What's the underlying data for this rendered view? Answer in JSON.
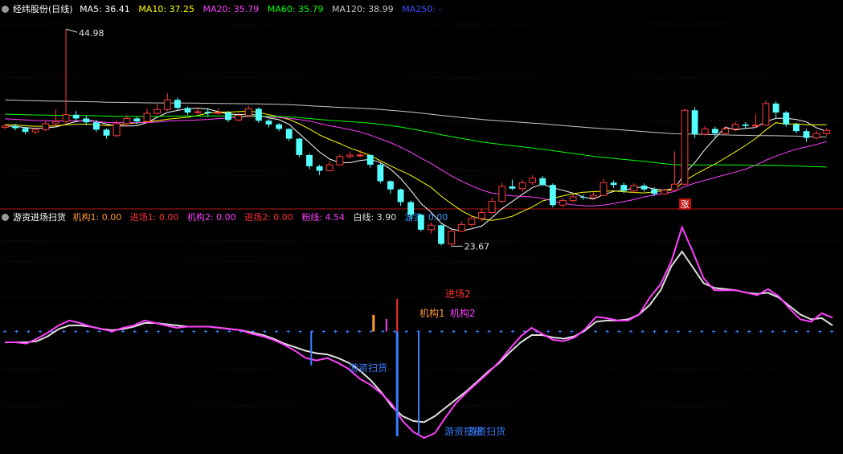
{
  "main_header": {
    "title": "经纬股份(日线)",
    "indicators": [
      {
        "label": "MA5: 36.41",
        "color": "#ffffff"
      },
      {
        "label": "MA10: 37.25",
        "color": "#ffff00"
      },
      {
        "label": "MA20: 35.79",
        "color": "#ff40ff"
      },
      {
        "label": "MA60: 35.79",
        "color": "#00ff00"
      },
      {
        "label": "MA120: 38.99",
        "color": "#c8c8c8"
      },
      {
        "label": "MA250: -",
        "color": "#3c50ff"
      }
    ]
  },
  "sub_header": {
    "title": "游资进场扫货",
    "indicators": [
      {
        "label": "机构1: 0.00",
        "color": "#ff9933"
      },
      {
        "label": "进场1: 0.00",
        "color": "#ff3030"
      },
      {
        "label": "机构2: 0.00",
        "color": "#ff40ff"
      },
      {
        "label": "进场2: 0.00",
        "color": "#ff3030"
      },
      {
        "label": "粉线: 4.54",
        "color": "#ff40ff"
      },
      {
        "label": "白线: 3.90",
        "color": "#e0e0e0"
      },
      {
        "label": "游资: 0.00",
        "color": "#3399ff"
      }
    ]
  },
  "chart_data": [
    {
      "type": "candlestick",
      "title": "经纬股份(日线)",
      "price_range": [
        22.5,
        46.5
      ],
      "up_color": "#ff3c3c",
      "down_color": "#54ffff",
      "candles": [
        [
          31.8,
          32.0,
          32.2,
          31.6
        ],
        [
          32.0,
          31.7,
          32.3,
          31.4
        ],
        [
          31.7,
          31.2,
          31.9,
          30.9
        ],
        [
          31.2,
          31.5,
          31.8,
          30.9
        ],
        [
          31.5,
          32.3,
          32.7,
          31.3
        ],
        [
          32.3,
          32.6,
          34.2,
          32.0
        ],
        [
          32.6,
          33.5,
          44.98,
          32.2
        ],
        [
          33.5,
          33.0,
          34.0,
          32.6
        ],
        [
          33.0,
          32.5,
          33.4,
          32.1
        ],
        [
          32.5,
          31.5,
          32.8,
          31.2
        ],
        [
          31.5,
          30.7,
          31.7,
          30.3
        ],
        [
          30.7,
          32.3,
          32.7,
          30.5
        ],
        [
          32.3,
          33.0,
          33.4,
          31.9
        ],
        [
          33.0,
          32.6,
          33.2,
          32.2
        ],
        [
          32.6,
          33.7,
          34.3,
          32.4
        ],
        [
          33.7,
          34.2,
          34.9,
          33.5
        ],
        [
          34.2,
          35.5,
          36.4,
          34.0
        ],
        [
          35.5,
          34.4,
          35.8,
          34.2
        ],
        [
          34.4,
          33.8,
          34.6,
          33.5
        ],
        [
          33.8,
          33.9,
          34.5,
          33.6
        ],
        [
          33.9,
          33.7,
          34.4,
          33.2
        ],
        [
          33.7,
          33.8,
          34.4,
          33.5
        ],
        [
          33.8,
          32.8,
          34.0,
          32.5
        ],
        [
          32.8,
          33.4,
          33.8,
          32.6
        ],
        [
          33.4,
          34.3,
          34.7,
          33.2
        ],
        [
          34.3,
          32.7,
          34.5,
          32.4
        ],
        [
          32.7,
          32.2,
          32.9,
          31.8
        ],
        [
          32.2,
          31.6,
          32.4,
          31.3
        ],
        [
          31.6,
          30.3,
          31.7,
          30.0
        ],
        [
          30.3,
          28.1,
          30.4,
          27.8
        ],
        [
          28.1,
          26.6,
          28.3,
          26.2
        ],
        [
          26.6,
          26.0,
          26.8,
          25.4
        ],
        [
          26.0,
          26.8,
          27.3,
          25.9
        ],
        [
          26.8,
          27.9,
          28.2,
          26.7
        ],
        [
          27.9,
          28.1,
          28.6,
          27.6
        ],
        [
          28.1,
          28.1,
          28.8,
          27.8
        ],
        [
          28.1,
          26.8,
          28.2,
          26.4
        ],
        [
          26.8,
          24.6,
          27.0,
          24.3
        ],
        [
          24.6,
          23.5,
          24.7,
          22.9
        ],
        [
          23.5,
          21.8,
          23.6,
          21.3
        ],
        [
          21.8,
          20.1,
          22.0,
          19.5
        ],
        [
          20.1,
          18.1,
          20.2,
          17.9
        ],
        [
          18.1,
          18.7,
          19.1,
          17.6
        ],
        [
          18.7,
          16.2,
          18.8,
          16.0
        ],
        [
          16.2,
          17.9,
          18.1,
          15.9
        ],
        [
          17.9,
          18.8,
          19.2,
          17.8
        ],
        [
          18.8,
          19.6,
          20.0,
          18.5
        ],
        [
          19.6,
          20.4,
          20.9,
          19.2
        ],
        [
          20.4,
          21.9,
          22.4,
          20.2
        ],
        [
          21.9,
          23.9,
          24.4,
          21.7
        ],
        [
          23.9,
          23.6,
          24.8,
          23.4
        ],
        [
          23.6,
          24.4,
          24.8,
          23.2
        ],
        [
          24.4,
          25.0,
          25.4,
          24.1
        ],
        [
          25.0,
          24.1,
          25.3,
          23.9
        ],
        [
          24.1,
          21.4,
          24.3,
          21.1
        ],
        [
          21.4,
          22.0,
          22.4,
          21.1
        ],
        [
          22.0,
          22.5,
          22.9,
          21.8
        ],
        [
          22.5,
          22.4,
          22.8,
          22.1
        ],
        [
          22.4,
          22.7,
          23.1,
          22.2
        ],
        [
          22.7,
          24.4,
          24.9,
          22.6
        ],
        [
          24.4,
          24.1,
          24.7,
          23.7
        ],
        [
          24.1,
          23.3,
          24.4,
          23.0
        ],
        [
          23.3,
          24.0,
          24.3,
          23.0
        ],
        [
          24.0,
          23.5,
          24.3,
          23.2
        ],
        [
          23.5,
          22.9,
          23.8,
          22.6
        ],
        [
          22.9,
          23.4,
          23.6,
          22.8
        ],
        [
          23.4,
          24.2,
          28.6,
          24.0
        ],
        [
          24.2,
          34.1,
          34.3,
          24.1
        ],
        [
          34.1,
          30.9,
          34.5,
          30.4
        ],
        [
          30.9,
          31.6,
          32.0,
          30.7
        ],
        [
          31.6,
          31.0,
          31.9,
          30.4
        ],
        [
          31.0,
          31.6,
          32.0,
          30.8
        ],
        [
          31.6,
          32.2,
          32.5,
          31.3
        ],
        [
          32.2,
          32.0,
          32.5,
          31.6
        ],
        [
          32.0,
          32.1,
          33.6,
          31.7
        ],
        [
          32.1,
          35.0,
          35.4,
          32.0
        ],
        [
          35.0,
          33.8,
          35.3,
          33.0
        ],
        [
          33.8,
          32.2,
          34.0,
          31.9
        ],
        [
          32.2,
          31.3,
          32.4,
          31.0
        ],
        [
          31.3,
          30.4,
          31.6,
          29.9
        ],
        [
          30.4,
          31.0,
          31.4,
          30.2
        ],
        [
          31.0,
          31.4,
          31.7,
          30.7
        ]
      ],
      "annotations": [
        {
          "text": "44.98",
          "kind": "high"
        },
        {
          "text": "23.67",
          "kind": "low"
        },
        {
          "text": "涨"
        }
      ]
    },
    {
      "type": "line",
      "title": "游资进场扫货",
      "y_range": [
        0,
        12
      ],
      "base_level": 3.4,
      "series": [
        {
          "name": "粉线",
          "color": "#ff40ff",
          "values": [
            2.5,
            2.5,
            2.4,
            2.8,
            3.3,
            3.9,
            4.3,
            4.1,
            3.8,
            3.6,
            3.4,
            3.7,
            3.9,
            4.3,
            4.1,
            3.9,
            3.7,
            3.8,
            3.8,
            3.8,
            3.7,
            3.6,
            3.5,
            3.2,
            3.0,
            2.7,
            2.3,
            1.8,
            1.2,
            1.0,
            1.2,
            0.8,
            0.3,
            -0.5,
            -1.0,
            -1.7,
            -2.6,
            -4.0,
            -4.9,
            -5.4,
            -5.0,
            -3.7,
            -2.5,
            -1.6,
            -0.8,
            0.0,
            0.9,
            2.0,
            3.0,
            3.7,
            3.2,
            2.7,
            2.6,
            2.9,
            3.6,
            4.6,
            4.5,
            4.3,
            4.3,
            4.8,
            6.2,
            7.3,
            9.2,
            12.0,
            10.0,
            7.8,
            6.8,
            6.8,
            6.8,
            6.6,
            6.4,
            6.9,
            6.3,
            5.3,
            4.4,
            4.2,
            4.9,
            4.54
          ]
        },
        {
          "name": "白线",
          "color": "#e0e0e0",
          "values": [
            2.5,
            2.5,
            2.5,
            2.6,
            3.0,
            3.6,
            3.9,
            3.9,
            3.8,
            3.6,
            3.5,
            3.6,
            3.8,
            4.1,
            4.1,
            4.0,
            3.9,
            3.8,
            3.8,
            3.8,
            3.7,
            3.6,
            3.5,
            3.3,
            3.1,
            2.8,
            2.4,
            2.1,
            1.8,
            1.6,
            1.5,
            1.2,
            0.8,
            0.2,
            -0.6,
            -1.6,
            -2.8,
            -3.6,
            -4.0,
            -4.1,
            -3.6,
            -2.9,
            -2.2,
            -1.5,
            -0.7,
            0.1,
            0.8,
            1.7,
            2.5,
            3.1,
            3.1,
            2.9,
            2.8,
            3.0,
            3.5,
            4.2,
            4.3,
            4.3,
            4.4,
            4.8,
            5.6,
            6.8,
            8.8,
            10.0,
            8.7,
            7.4,
            7.0,
            6.9,
            6.8,
            6.6,
            6.5,
            6.6,
            6.2,
            5.5,
            4.8,
            4.4,
            4.5,
            3.9
          ]
        }
      ],
      "signals": [
        {
          "label": "游资扫货"
        },
        {
          "label": "机构1"
        },
        {
          "label": "机构2"
        },
        {
          "label": "进场2"
        },
        {
          "label": "游资扫货"
        },
        {
          "label": "游资扫货"
        }
      ]
    }
  ]
}
